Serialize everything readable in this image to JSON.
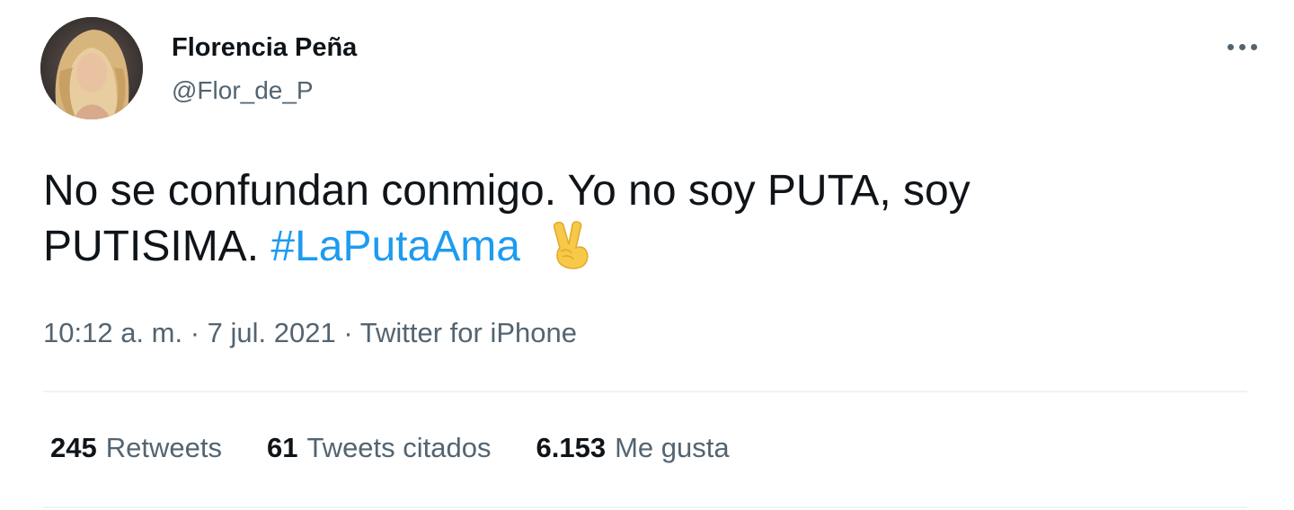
{
  "author": {
    "display_name": "Florencia Peña",
    "handle": "@Flor_de_P"
  },
  "tweet": {
    "text_line1": "No se confundan conmigo. Yo no soy PUTA, soy",
    "text_line2": "PUTISIMA.",
    "hashtag": "#LaPutaAma",
    "emoji": "victory-hand-emoji"
  },
  "meta": {
    "time": "10:12 a. m.",
    "separator": "·",
    "date": "7 jul. 2021",
    "source": "Twitter for iPhone"
  },
  "stats": {
    "retweets_count": "245",
    "retweets_label": "Retweets",
    "quotes_count": "61",
    "quotes_label": "Tweets citados",
    "likes_count": "6.153",
    "likes_label": "Me gusta"
  },
  "colors": {
    "text": "#0f1419",
    "secondary": "#536471",
    "link": "#1d9bf0",
    "divider": "#eff3f4"
  }
}
